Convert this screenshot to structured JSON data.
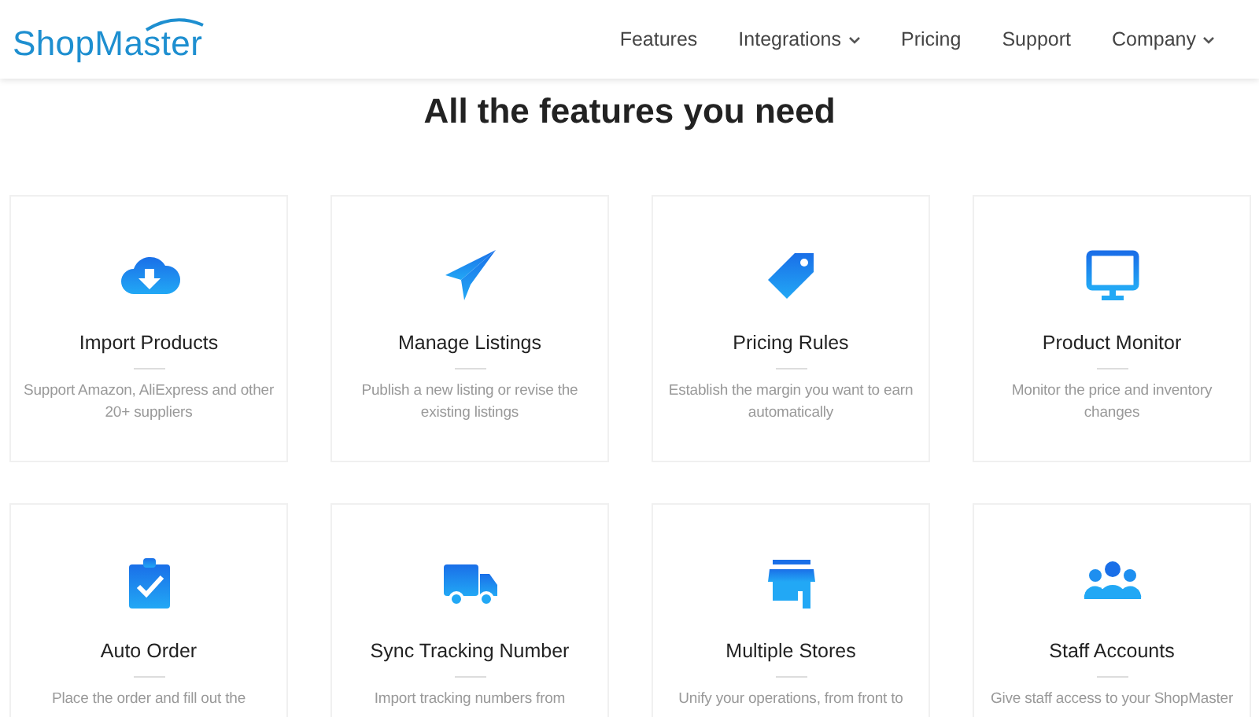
{
  "header": {
    "logo": "ShopMaster",
    "nav": [
      {
        "label": "Features",
        "dropdown": false
      },
      {
        "label": "Integrations",
        "dropdown": true
      },
      {
        "label": "Pricing",
        "dropdown": false
      },
      {
        "label": "Support",
        "dropdown": false
      },
      {
        "label": "Company",
        "dropdown": true
      }
    ]
  },
  "section": {
    "title": "All the features you need",
    "features": [
      {
        "kind": "cloud",
        "title": "Import Products",
        "description": "Support Amazon, AliExpress and other 20+ suppliers"
      },
      {
        "kind": "plane",
        "title": "Manage Listings",
        "description": "Publish a new listing or revise the existing listings"
      },
      {
        "kind": "tag",
        "title": "Pricing Rules",
        "description": "Establish the margin you want to earn automatically"
      },
      {
        "kind": "monitor",
        "title": "Product Monitor",
        "description": "Monitor the price and inventory changes"
      },
      {
        "kind": "clipboard",
        "title": "Auto Order",
        "description": "Place the order and fill out the"
      },
      {
        "kind": "truck",
        "title": "Sync Tracking Number",
        "description": "Import tracking numbers from"
      },
      {
        "kind": "store",
        "title": "Multiple Stores",
        "description": "Unify your operations, from front to"
      },
      {
        "kind": "team",
        "title": "Staff Accounts",
        "description": "Give staff access to your ShopMaster"
      }
    ]
  }
}
